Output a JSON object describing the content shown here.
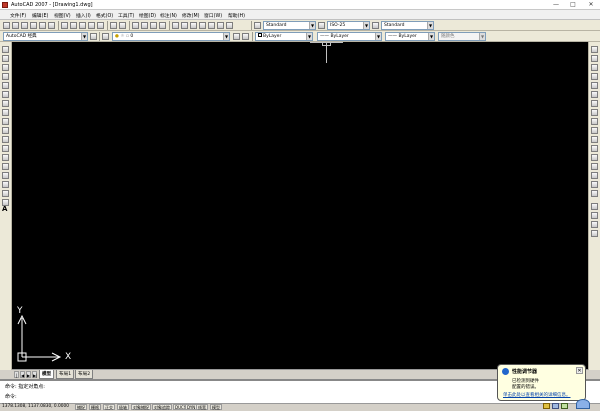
{
  "window": {
    "title": "AutoCAD 2007 - [Drawing1.dwg]",
    "controls": [
      "—",
      "□",
      "✕"
    ]
  },
  "menu": [
    "文件(F)",
    "编辑(E)",
    "视图(V)",
    "插入(I)",
    "格式(O)",
    "工具(T)",
    "绘图(D)",
    "标注(N)",
    "修改(M)",
    "窗口(W)",
    "帮助(H)"
  ],
  "toolbar_row1": {
    "text_style": "Standard",
    "dim_style": "ISO-25",
    "table_style": "Standard"
  },
  "toolbar_row2": {
    "workspace": "AutoCAD 经典",
    "layer": "0",
    "color": "ByLayer",
    "linetype": "ByLayer",
    "lineweight": "ByLayer",
    "plot_style": "随颜色"
  },
  "tabs": {
    "model": "模型",
    "layout1": "布局1",
    "layout2": "布局2"
  },
  "ucs": {
    "x_label": "X",
    "y_label": "Y"
  },
  "command": {
    "line1": "命令: 指定对角点:",
    "line2": "命令:"
  },
  "status": {
    "coords": "1378.1308, 1137.0830, 0.0000",
    "buttons": [
      "捕捉",
      "栅格",
      "正交",
      "极轴",
      "对象捕捉",
      "对象追踪",
      "DUCS",
      "DYN",
      "线宽",
      "模型"
    ]
  },
  "balloon": {
    "title": "性能调节器",
    "line1": "已检测到硬件",
    "line2": "配置的错误。",
    "link": "单击此处以查看相关的详细信息。"
  },
  "colors": {
    "canvas": "#000000",
    "crosshair": "#c0c0c0",
    "ucs": "#ffffff"
  }
}
